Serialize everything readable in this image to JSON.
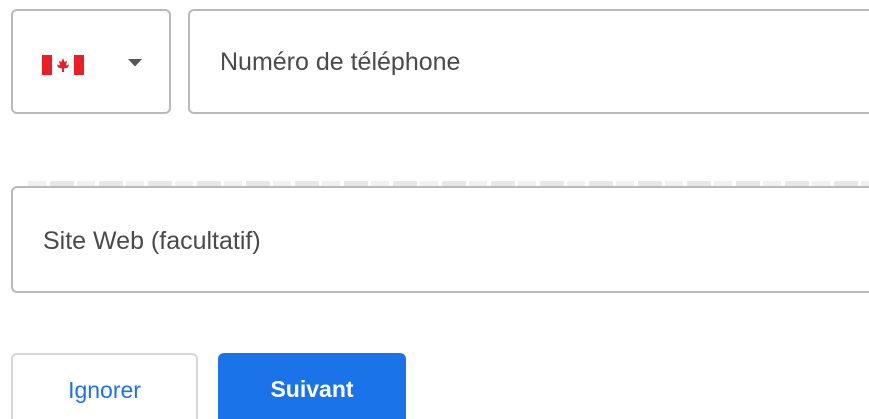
{
  "country_select": {
    "flag_icon": "canada-flag-icon",
    "dropdown_icon": "caret-down-icon"
  },
  "phone": {
    "placeholder": "Numéro de téléphone"
  },
  "website": {
    "placeholder": "Site Web (facultatif)"
  },
  "actions": {
    "ignore_label": "Ignorer",
    "next_label": "Suivant"
  },
  "colors": {
    "accent": "#1a73e8",
    "border": "#b9b9b9",
    "flag_red": "#ee1c25"
  }
}
